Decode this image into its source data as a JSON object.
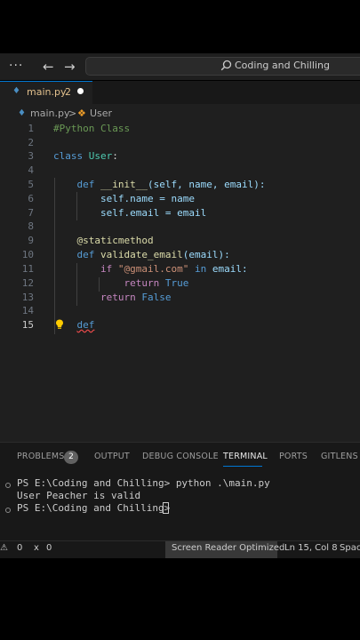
{
  "titlebar": {
    "menu_label": "···",
    "back_label": "←",
    "forward_label": "→",
    "search_text": "Coding and Chilling"
  },
  "tab": {
    "filename": "main.py",
    "problem_count": "2"
  },
  "breadcrumb": {
    "file": "main.py",
    "separator": ">",
    "symbol": "User"
  },
  "editor": {
    "line_numbers": [
      "1",
      "2",
      "3",
      "4",
      "5",
      "6",
      "7",
      "8",
      "9",
      "10",
      "11",
      "12",
      "13",
      "14",
      "15"
    ],
    "current_line": "15",
    "code": {
      "l1_comment": "#Python Class",
      "l3_class_kw": "class",
      "l3_class_name": "User",
      "l3_colon": ":",
      "l5_def": "def",
      "l5_name": "__init__",
      "l5_params": "(self, name, email):",
      "l6_text": "self.name = name",
      "l7_text": "self.email = email",
      "l9_decorator": "@staticmethod",
      "l10_def": "def",
      "l10_name": "validate_email",
      "l10_params": "(email):",
      "l11_if": "if",
      "l11_string": "\"@gmail.com\"",
      "l11_in": "in",
      "l11_rest": "email:",
      "l12_return": "return",
      "l12_value": "True",
      "l13_return": "return",
      "l13_value": "False",
      "l15_def": "def"
    }
  },
  "panel": {
    "tabs": [
      "PROBLEMS",
      "OUTPUT",
      "DEBUG CONSOLE",
      "TERMINAL",
      "PORTS",
      "GITLENS"
    ],
    "problems_badge": "2",
    "active_tab": "TERMINAL",
    "terminal": {
      "line1_prompt": "PS E:\\Coding and Chilling>",
      "line1_cmd": "python .\\main.py",
      "line2_output": "User Peacher is valid",
      "line3_prompt": "PS E:\\Coding and Chilling>"
    }
  },
  "statusbar": {
    "errors": "0",
    "ports": "0",
    "screen_reader": "Screen Reader Optimized",
    "position": "Ln 15, Col 8",
    "spaces": "Spac"
  },
  "colors": {
    "editor_bg": "#1f1f1f",
    "accent": "#0078d4",
    "keyword": "#569cd6",
    "string": "#ce9178",
    "comment": "#6a9955"
  }
}
